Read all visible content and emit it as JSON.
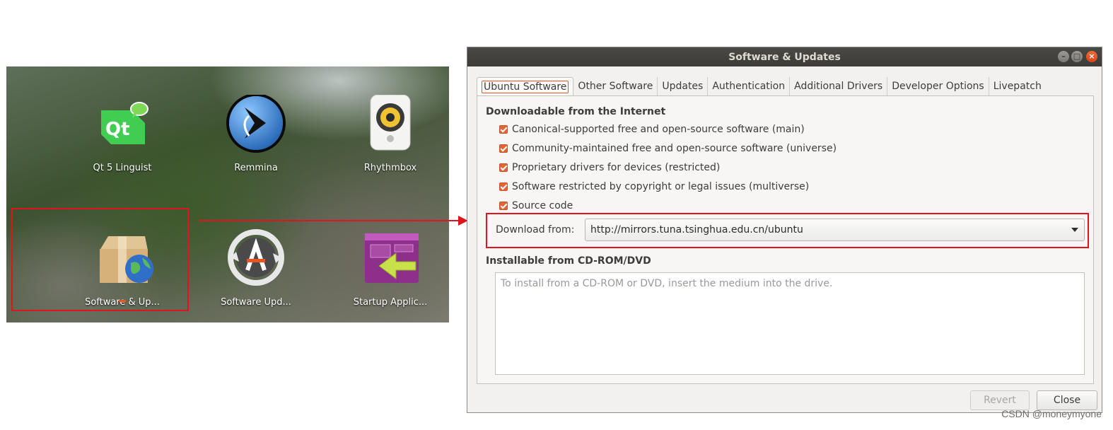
{
  "launcher": {
    "apps": [
      {
        "label": "Qt 5 Linguist",
        "icon": "qt-linguist-icon"
      },
      {
        "label": "Remmina",
        "icon": "remmina-icon"
      },
      {
        "label": "Rhythmbox",
        "icon": "rhythmbox-icon"
      },
      {
        "label": "Software & Up...",
        "icon": "software-updates-icon"
      },
      {
        "label": "Software Upd...",
        "icon": "software-updater-icon"
      },
      {
        "label": "Startup Applic...",
        "icon": "startup-applications-icon"
      }
    ],
    "highlight_color": "#e0141e",
    "running_indicator_color": "#e95420"
  },
  "dialog": {
    "title": "Software & Updates",
    "tabs": [
      {
        "label": "Ubuntu Software",
        "active": true
      },
      {
        "label": "Other Software"
      },
      {
        "label": "Updates"
      },
      {
        "label": "Authentication"
      },
      {
        "label": "Additional Drivers"
      },
      {
        "label": "Developer Options"
      },
      {
        "label": "Livepatch"
      }
    ],
    "downloadable_section": {
      "title": "Downloadable from the Internet",
      "options": [
        {
          "label": "Canonical-supported free and open-source software (main)",
          "checked": true
        },
        {
          "label": "Community-maintained free and open-source software (universe)",
          "checked": true
        },
        {
          "label": "Proprietary drivers for devices (restricted)",
          "checked": true
        },
        {
          "label": "Software restricted by copyright or legal issues (multiverse)",
          "checked": true
        },
        {
          "label": "Source code",
          "checked": true
        }
      ],
      "download_from_label": "Download from:",
      "download_from_value": "http://mirrors.tuna.tsinghua.edu.cn/ubuntu"
    },
    "cdrom_section": {
      "title": "Installable from CD-ROM/DVD",
      "placeholder": "To install from a CD-ROM or DVD, insert the medium into the drive."
    },
    "buttons": {
      "revert": "Revert",
      "close": "Close"
    },
    "accent_color": "#e95420"
  },
  "watermark": "CSDN @moneymyone"
}
